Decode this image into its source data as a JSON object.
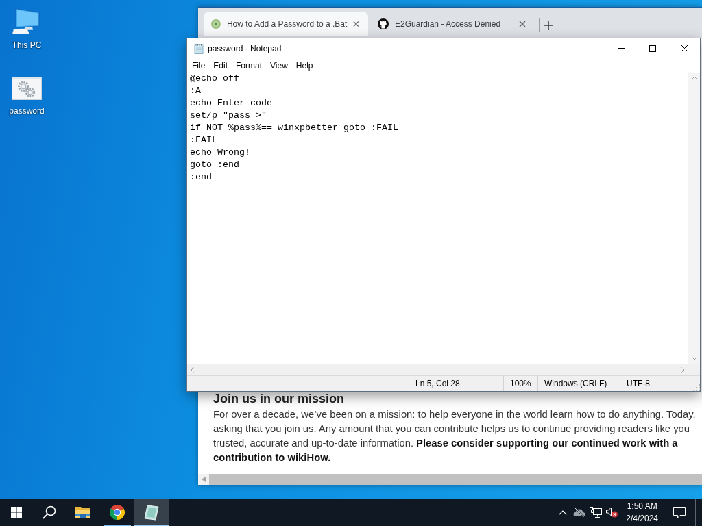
{
  "desktop": {
    "icons": [
      {
        "kind": "computer",
        "label": "This PC"
      },
      {
        "kind": "settings-file",
        "label": "password"
      }
    ]
  },
  "browser": {
    "tabs": [
      {
        "kind": "wikihow",
        "title": "How to Add a Password to a .Bat",
        "selected": true
      },
      {
        "kind": "github",
        "title": "E2Guardian - Access Denied",
        "selected": false
      }
    ],
    "page": {
      "heading": "Join us in our mission",
      "body": "For over a decade, we’ve been on a mission: to help everyone in the world learn how to do anything. Today, asking that you join us. Any amount that you can contribute helps us to continue providing readers like you trusted, accurate and up-to-date information. **Please consider supporting our continued work with a contribution to wikiHow.**"
    }
  },
  "notepad": {
    "title": "password - Notepad",
    "menu": [
      "File",
      "Edit",
      "Format",
      "View",
      "Help"
    ],
    "content": "@echo off\n:A\necho Enter code\nset/p \"pass=>\"\nif NOT %pass%== winxpbetter goto :FAIL\n:FAIL\necho Wrong!\ngoto :end\n:end",
    "status": [
      "Ln 5, Col 28",
      "100%",
      "Windows (CRLF)",
      "UTF-8"
    ]
  },
  "taskbar": {
    "apps": [
      {
        "kind": "file-explorer",
        "running": false,
        "selected": false
      },
      {
        "kind": "chrome",
        "running": true,
        "selected": false
      },
      {
        "kind": "notepad",
        "running": true,
        "selected": true
      }
    ],
    "tray": {
      "volume_muted": true,
      "time": "1:50 AM",
      "date": "2/4/2024"
    }
  }
}
